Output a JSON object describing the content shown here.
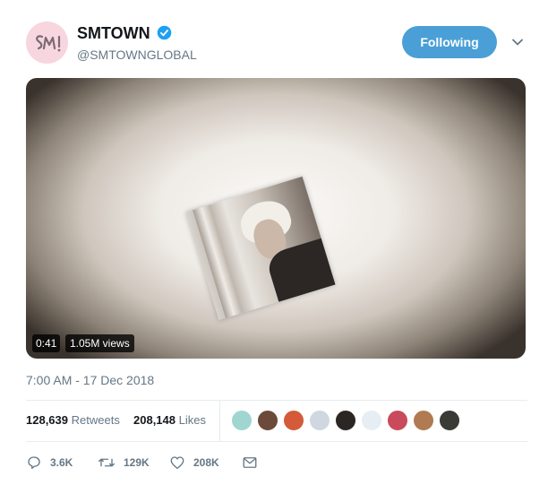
{
  "account": {
    "display_name": "SMTOWN",
    "handle": "@SMTOWNGLOBAL",
    "verified": true,
    "avatar_icon": "smtown-logo-icon",
    "avatar_color": "#f8d6df"
  },
  "follow_button": {
    "label": "Following",
    "color": "#4a9fd6"
  },
  "more_menu_icon": "chevron-down-icon",
  "video": {
    "duration": "0:41",
    "views": "1.05M views"
  },
  "tweet": {
    "timestamp": "7:00 AM - 17 Dec 2018"
  },
  "stats": {
    "retweets_count": "128,639",
    "retweets_label": "Retweets",
    "likes_count": "208,148",
    "likes_label": "Likes",
    "liker_avatars": [
      {
        "color": "#9fd6d2"
      },
      {
        "color": "#6b4a3a"
      },
      {
        "color": "#d45a3a"
      },
      {
        "color": "#cfd8e0"
      },
      {
        "color": "#2b2624"
      },
      {
        "color": "#e6eef4"
      },
      {
        "color": "#c94a5a"
      },
      {
        "color": "#b07a52"
      },
      {
        "color": "#3a3a36"
      }
    ]
  },
  "actions": {
    "reply_count": "3.6K",
    "retweet_count": "129K",
    "like_count": "208K",
    "reply_icon": "reply-icon",
    "retweet_icon": "retweet-icon",
    "like_icon": "heart-icon",
    "dm_icon": "envelope-icon"
  }
}
